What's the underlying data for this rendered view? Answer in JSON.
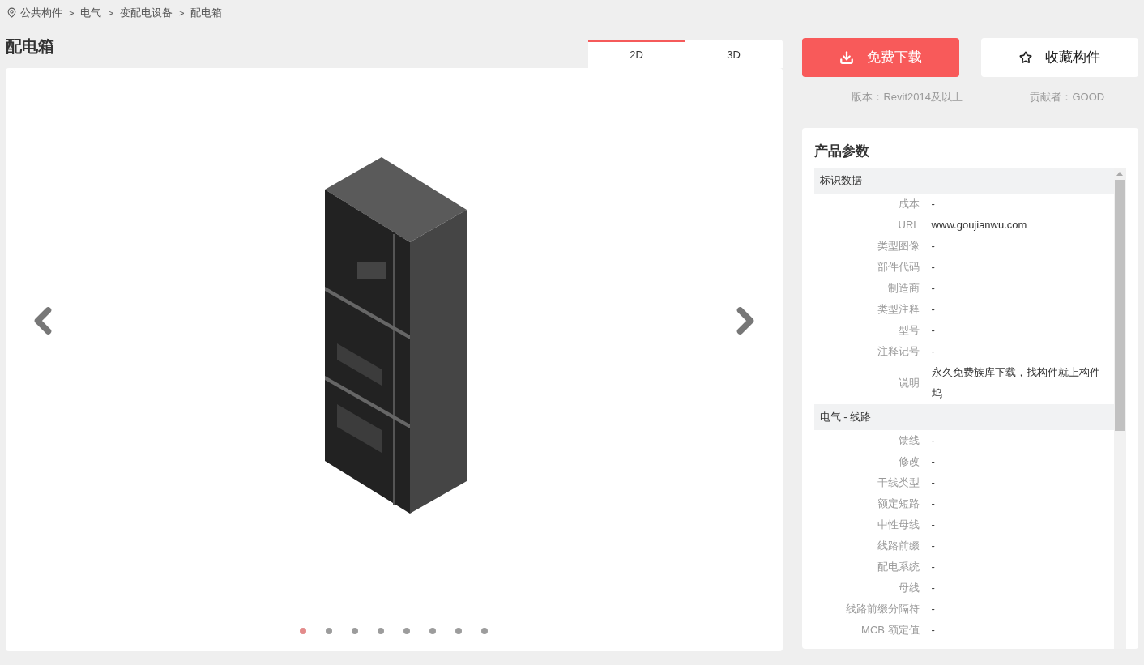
{
  "breadcrumb": [
    "公共构件",
    "电气",
    "变配电设备",
    "配电箱"
  ],
  "breadcrumb_separator": ">",
  "title": "配电箱",
  "view_tabs": [
    {
      "label": "2D",
      "selected": true
    },
    {
      "label": "3D",
      "selected": false
    }
  ],
  "carousel_dots": [
    {
      "selected": true
    },
    {
      "selected": false
    },
    {
      "selected": false
    },
    {
      "selected": false
    },
    {
      "selected": false
    },
    {
      "selected": false
    },
    {
      "selected": false
    },
    {
      "selected": false
    }
  ],
  "download_button": "免费下载",
  "favorite_button": "收藏构件",
  "version": "版本：Revit2014及以上",
  "contributor": "贡献者：GOOD",
  "params": {
    "title": "产品参数",
    "groups": [
      {
        "name": "标识数据",
        "rows": [
          {
            "label": "成本",
            "value": "-"
          },
          {
            "label": "URL",
            "value": "www.goujianwu.com"
          },
          {
            "label": "类型图像",
            "value": "-"
          },
          {
            "label": "部件代码",
            "value": "-"
          },
          {
            "label": "制造商",
            "value": "-"
          },
          {
            "label": "类型注释",
            "value": "-"
          },
          {
            "label": "型号",
            "value": "-"
          },
          {
            "label": "注释记号",
            "value": "-"
          },
          {
            "label": "说明",
            "value": "永久免费族库下载，找构件就上构件坞"
          }
        ]
      },
      {
        "name": "电气 - 线路",
        "rows": [
          {
            "label": "馈线",
            "value": "-"
          },
          {
            "label": "修改",
            "value": "-"
          },
          {
            "label": "干线类型",
            "value": "-"
          },
          {
            "label": "额定短路",
            "value": "-"
          },
          {
            "label": "中性母线",
            "value": "-"
          },
          {
            "label": "线路前缀",
            "value": "-"
          },
          {
            "label": "配电系统",
            "value": "-"
          },
          {
            "label": "母线",
            "value": "-"
          },
          {
            "label": "线路前缀分隔符",
            "value": "-"
          },
          {
            "label": "MCB 额定值",
            "value": "-"
          }
        ]
      }
    ]
  }
}
